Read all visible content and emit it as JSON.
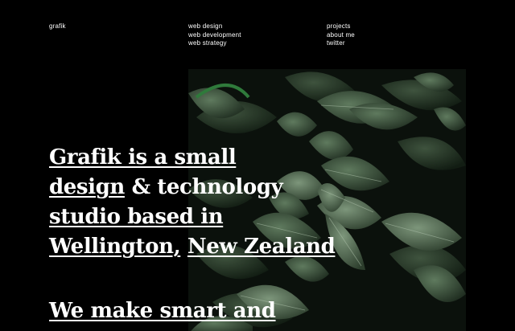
{
  "brand": {
    "name": "grafik"
  },
  "services": [
    "web design",
    "web development",
    "web strategy"
  ],
  "pages": [
    "projects",
    "about me",
    "twitter"
  ],
  "headline": {
    "line1": "Grafik is a small",
    "line2a": "design",
    "line2b": " & technology",
    "line3": "studio based in",
    "line4a": "Wellington,",
    "line4b": "New Zealand"
  },
  "tagline": {
    "text": "We make smart and"
  },
  "colors": {
    "background": "#000000",
    "text": "#ffffff"
  }
}
